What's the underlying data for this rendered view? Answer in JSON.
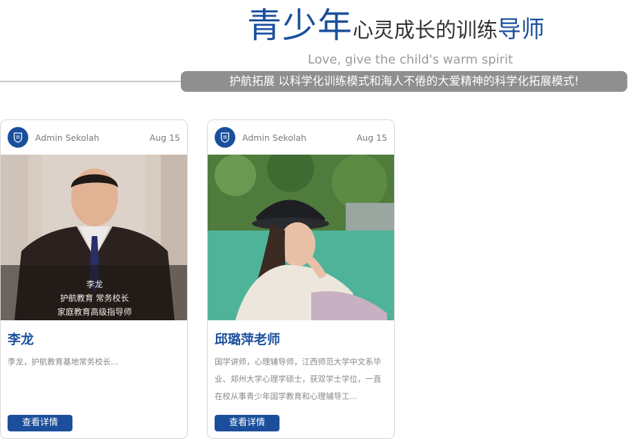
{
  "hero": {
    "title_big": "青少年",
    "title_small": "心灵成长的训练",
    "title_accent": "导师",
    "subtitle": "Love, give the child's warm spirit",
    "banner": "护航拓展 以科学化训练模式和海人不倦的大爱精神的科学化拓展模式!"
  },
  "cards": [
    {
      "author": "Admin Sekolah",
      "date": "Aug 15",
      "photo_caption_1": "李龙",
      "photo_caption_2": "护航教育  常务校长",
      "photo_caption_3": "家庭教育高级指导师",
      "name": "李龙",
      "description": "李龙，护航教育基地常务校长...",
      "button": "查看详情"
    },
    {
      "author": "Admin Sekolah",
      "date": "Aug 15",
      "name": "邱璐萍老师",
      "description": "国学讲师，心理辅导师，江西师范大学中文系毕业、郑州大学心理学硕士，获双学士学位，一直在校从事青少年国学教育和心理辅导工...",
      "button": "查看详情"
    }
  ],
  "colors": {
    "brand_blue": "#1b4f9c",
    "banner_gray": "#8f8f8f"
  }
}
